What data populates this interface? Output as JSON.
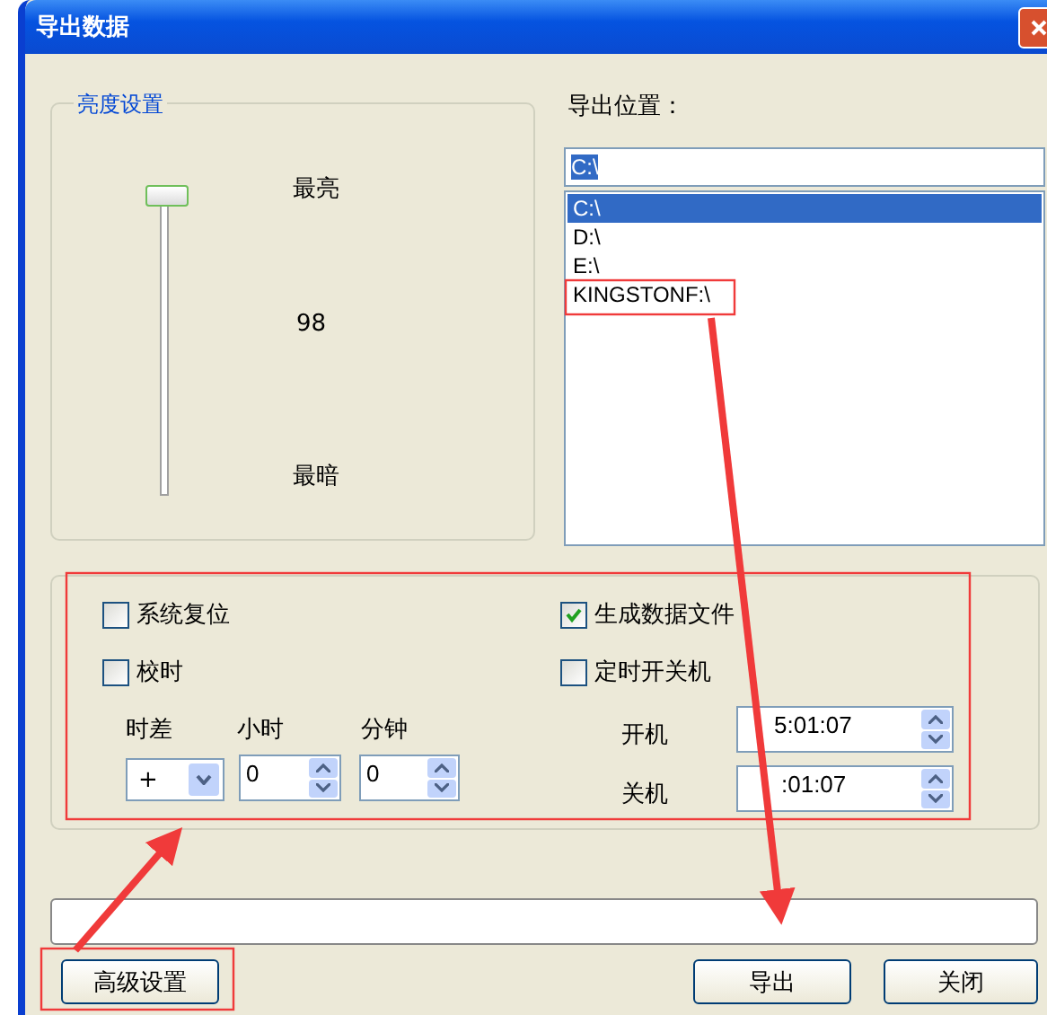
{
  "window": {
    "title": "导出数据"
  },
  "brightness": {
    "label": "亮度设置",
    "level": 0.98,
    "max_label": "最亮",
    "value": "98",
    "min_label": "最暗"
  },
  "export_location": {
    "label": "导出位置：",
    "value": "C:\\",
    "drives": [
      {
        "label": "C:\\",
        "selected": true
      },
      {
        "label": "D:\\",
        "selected": false
      },
      {
        "label": "E:\\",
        "selected": false
      },
      {
        "label": "KINGSTONF:\\",
        "selected": false
      }
    ]
  },
  "options": [
    {
      "label": "系统复位",
      "checked": false
    },
    {
      "label": "生成数据文件",
      "checked": true
    },
    {
      "label": "校时",
      "checked": false
    },
    {
      "label": "定时开关机",
      "checked": false
    }
  ],
  "time_offset": {
    "sign_label": "时差",
    "sign": "+",
    "hours_label": "小时",
    "hours": "0",
    "minutes_label": "分钟",
    "minutes": "0"
  },
  "schedule": [
    {
      "label": "开机",
      "value": "5:01:07"
    },
    {
      "label": "关机",
      "value": ":01:07"
    }
  ],
  "buttons": [
    "高级设置",
    "导出",
    "关闭"
  ]
}
